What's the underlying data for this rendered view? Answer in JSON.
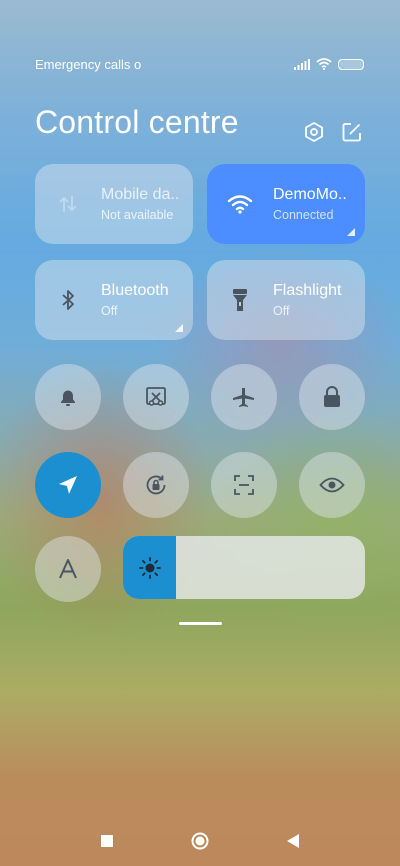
{
  "status_bar": {
    "carrier_text": "Emergency calls o"
  },
  "header": {
    "title": "Control centre"
  },
  "tiles": [
    {
      "id": "mobile-data",
      "label": "Mobile da..",
      "status": "Not available",
      "icon": "mobile-data-icon"
    },
    {
      "id": "wifi",
      "label": "DemoMo..",
      "status": "Connected",
      "icon": "wifi-icon"
    },
    {
      "id": "bluetooth",
      "label": "Bluetooth",
      "status": "Off",
      "icon": "bluetooth-icon"
    },
    {
      "id": "flashlight",
      "label": "Flashlight",
      "status": "Off",
      "icon": "flashlight-icon"
    }
  ],
  "toggles_row1": [
    "bell-icon",
    "screenshot-icon",
    "airplane-icon",
    "lock-icon"
  ],
  "toggles_row2": [
    "location-icon",
    "rotation-lock-icon",
    "scanner-icon",
    "eye-icon"
  ],
  "brightness": {
    "icon": "sun-icon",
    "level": 0.22
  },
  "auto_font_icon": "font-size-icon",
  "colors": {
    "accent_blue": "#4c8dff",
    "active_blue": "#1b8fcf"
  },
  "nav": [
    "recents-icon",
    "home-icon",
    "back-icon"
  ]
}
